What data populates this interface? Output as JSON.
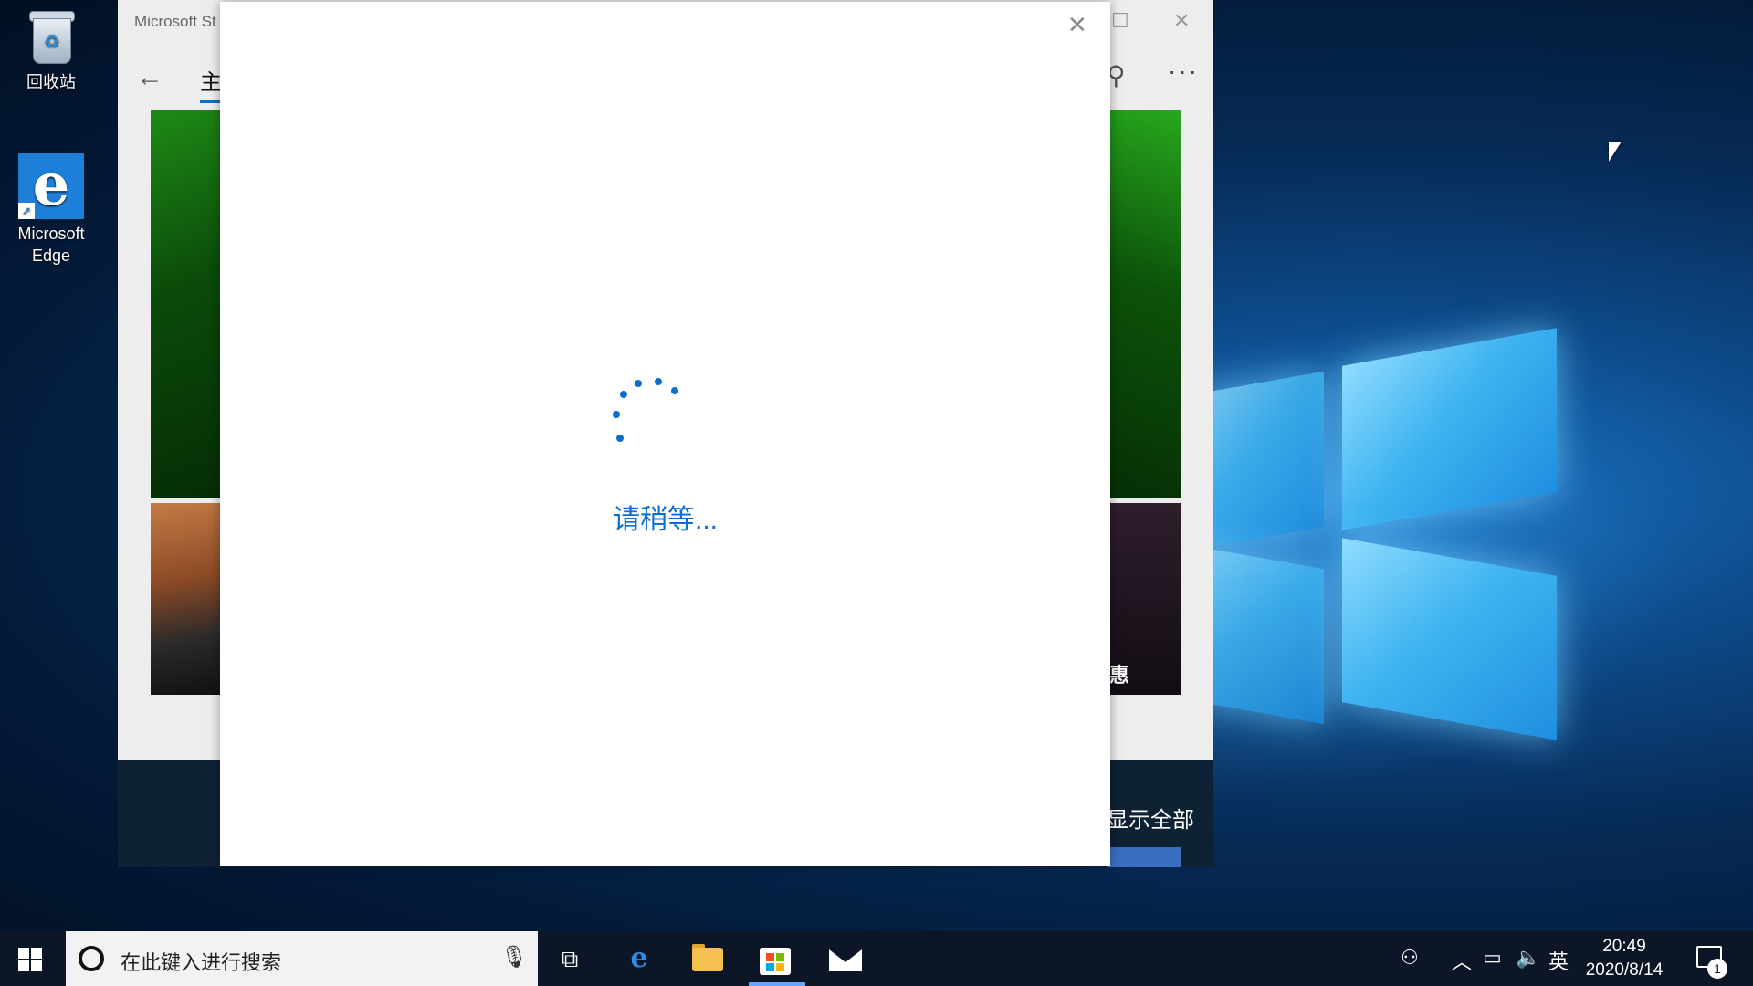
{
  "desktop": {
    "icons": [
      {
        "label": "回收站",
        "icon": "recycle-bin-icon"
      },
      {
        "label": "Microsoft Edge",
        "icon": "edge-icon"
      }
    ]
  },
  "store_window": {
    "title": "Microsoft St",
    "nav_tab": "主",
    "show_all": "显示全部",
    "tile_text": "惠",
    "more": "···"
  },
  "dialog": {
    "status_text": "请稍等...",
    "close_glyph": "✕"
  },
  "taskbar": {
    "search_placeholder": "在此键入进行搜索",
    "ime_label": "英",
    "time": "20:49",
    "date": "2020/8/14",
    "notification_count": "1",
    "pinned": [
      "task-view-icon",
      "edge-icon",
      "file-explorer-icon",
      "store-icon",
      "mail-icon"
    ]
  },
  "colors": {
    "accent": "#0a6ed1",
    "taskbar": "#0c1626"
  }
}
